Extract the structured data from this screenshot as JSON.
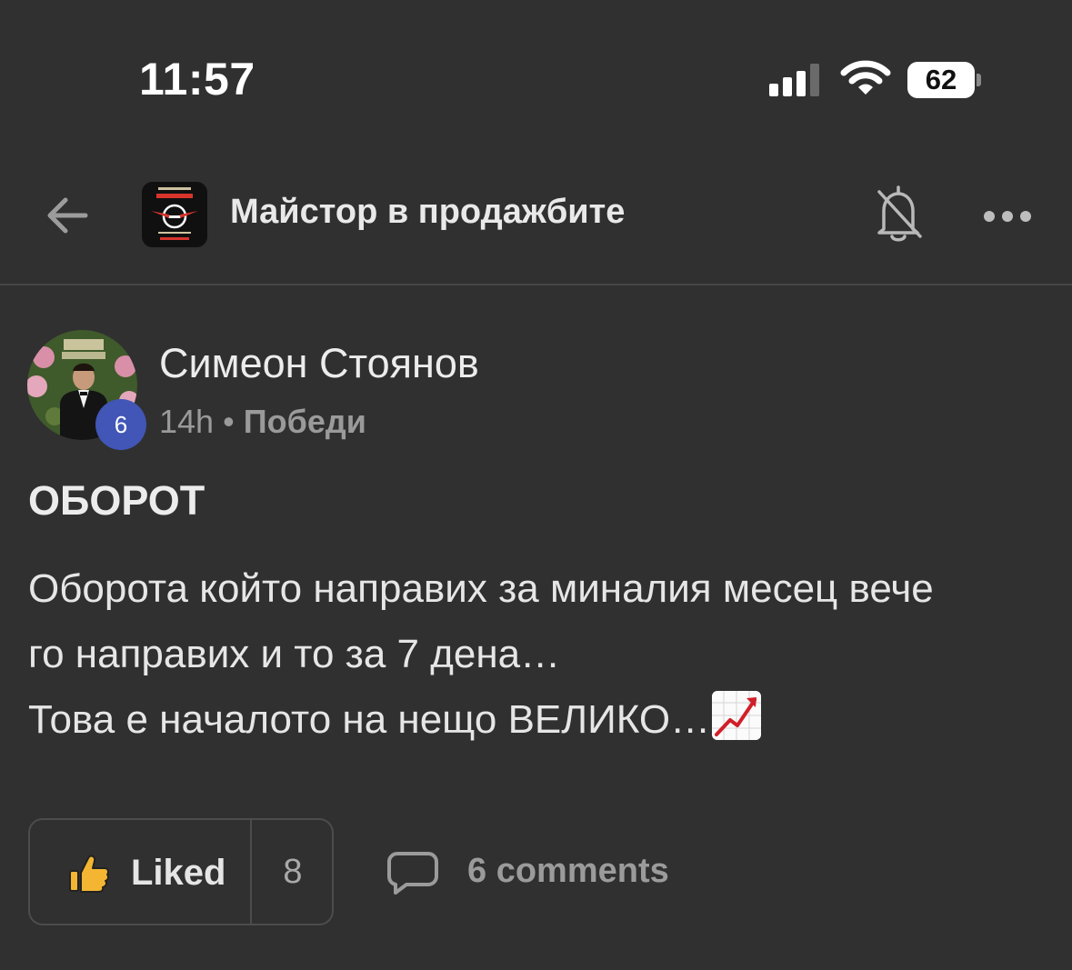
{
  "status_bar": {
    "time": "11:57",
    "battery": "62"
  },
  "header": {
    "title": "Майстор в продажбите"
  },
  "post": {
    "author": "Симеон Стоянов",
    "level": "6",
    "time": "14h",
    "separator": "•",
    "category": "Победи",
    "title": "ОБОРОТ",
    "body_lines": [
      "Оборота който направих за миналия месец вече",
      "го направих и то за 7 дена…",
      "Това е началото на нещо ВЕЛИКО…"
    ]
  },
  "actions": {
    "like_label": "Liked",
    "like_count": "8",
    "comments_label": "6 comments"
  },
  "colors": {
    "background": "#303030",
    "level_badge": "#4156b6",
    "like_thumb": "#f3b532"
  }
}
